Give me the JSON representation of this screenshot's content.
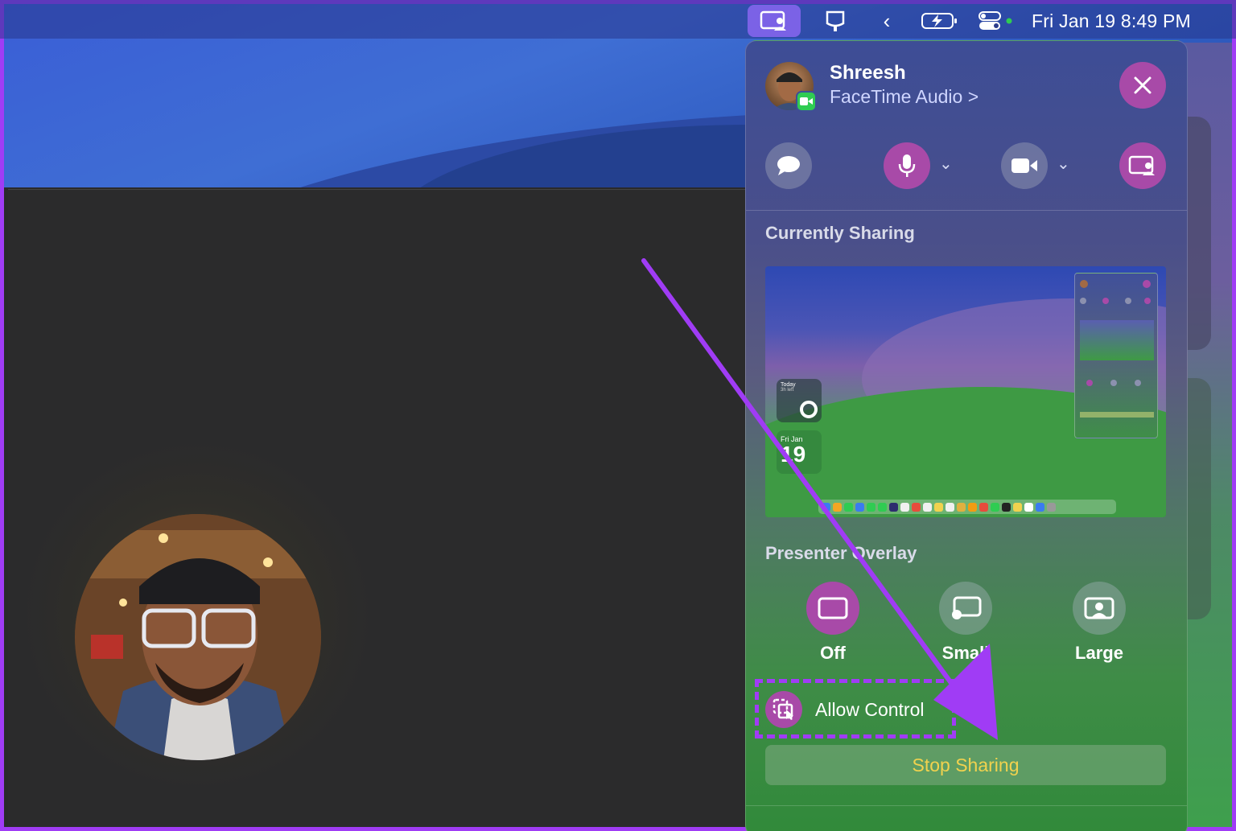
{
  "menubar": {
    "clock": "Fri Jan 19  8:49 PM"
  },
  "call": {
    "name": "Shreesh",
    "subtitle": "FaceTime Audio >"
  },
  "sections": {
    "currently_sharing": "Currently Sharing",
    "presenter_overlay": "Presenter Overlay"
  },
  "preview": {
    "widget_today": "Today",
    "widget_left": "3h left",
    "widget_date_label": "Fri Jan",
    "widget_date_number": "19"
  },
  "overlay_options": [
    {
      "label": "Off"
    },
    {
      "label": "Small"
    },
    {
      "label": "Large"
    }
  ],
  "allow_control": "Allow Control",
  "stop_sharing": "Stop Sharing",
  "colors": {
    "accent_purple": "#a03cf5",
    "pink_button": "#a84aa8",
    "stop_text": "#f1d24e"
  }
}
